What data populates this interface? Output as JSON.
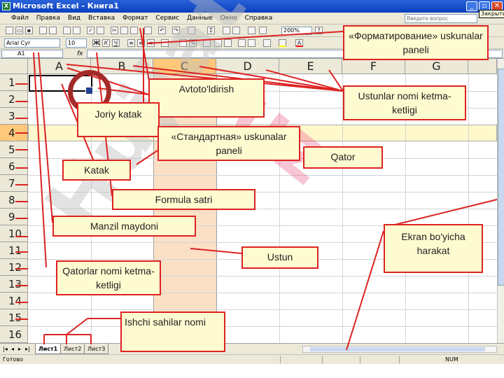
{
  "window": {
    "title": "Microsoft Excel - Книга1",
    "app_icon": "excel-icon",
    "close_tooltip": "Закрыть"
  },
  "menubar": {
    "items": [
      "Файл",
      "Правка",
      "Вид",
      "Вставка",
      "Формат",
      "Сервис",
      "Данные",
      "Окно",
      "Справка"
    ],
    "help_placeholder": "Введите вопрос"
  },
  "toolbar": {
    "font_name": "Arial Cyr",
    "font_size": "10",
    "zoom": "200%"
  },
  "formula_bar": {
    "name_box": "A1",
    "fx_label": "fx"
  },
  "grid": {
    "columns": [
      "A",
      "B",
      "C",
      "D",
      "E",
      "F",
      "G"
    ],
    "rows": [
      "1",
      "2",
      "3",
      "4",
      "5",
      "6",
      "7",
      "8",
      "9",
      "10",
      "11",
      "12",
      "13",
      "14",
      "15",
      "16"
    ],
    "selected_column": "C",
    "selected_row": "4",
    "active_cell": "A1"
  },
  "sheets": {
    "tabs": [
      "Лист1",
      "Лист2",
      "Лист3"
    ],
    "active": "Лист1"
  },
  "statusbar": {
    "left": "Готово",
    "num": "NUM"
  },
  "watermark": {
    "text_left": "Hujjat",
    "text_right": "uz"
  },
  "callouts": {
    "formatting_toolbar": "«Форматирование» uskunalar paneli",
    "autosum": "Avtoto'ldirish",
    "column_names": "Ustunlar nomi ketma-ketligi",
    "current_cell": "Joriy katak",
    "standard_toolbar": "«Стандартная» uskunalar paneli",
    "row": "Qator",
    "cell": "Katak",
    "formula_bar": "Formula satri",
    "name_box": "Manzil maydoni",
    "screen_scroll": "Ekran bo'yicha harakat",
    "column": "Ustun",
    "row_names": "Qatorlar nomi ketma-ketligi",
    "sheet_names": "Ishchi sahilar nomi"
  },
  "colors": {
    "title_bar": "#0a3fbf",
    "callout_border": "#dd2222",
    "callout_fill": "#fffbd0",
    "selected_header": "#ffc87a",
    "column_shade": "#fbe0c6"
  }
}
